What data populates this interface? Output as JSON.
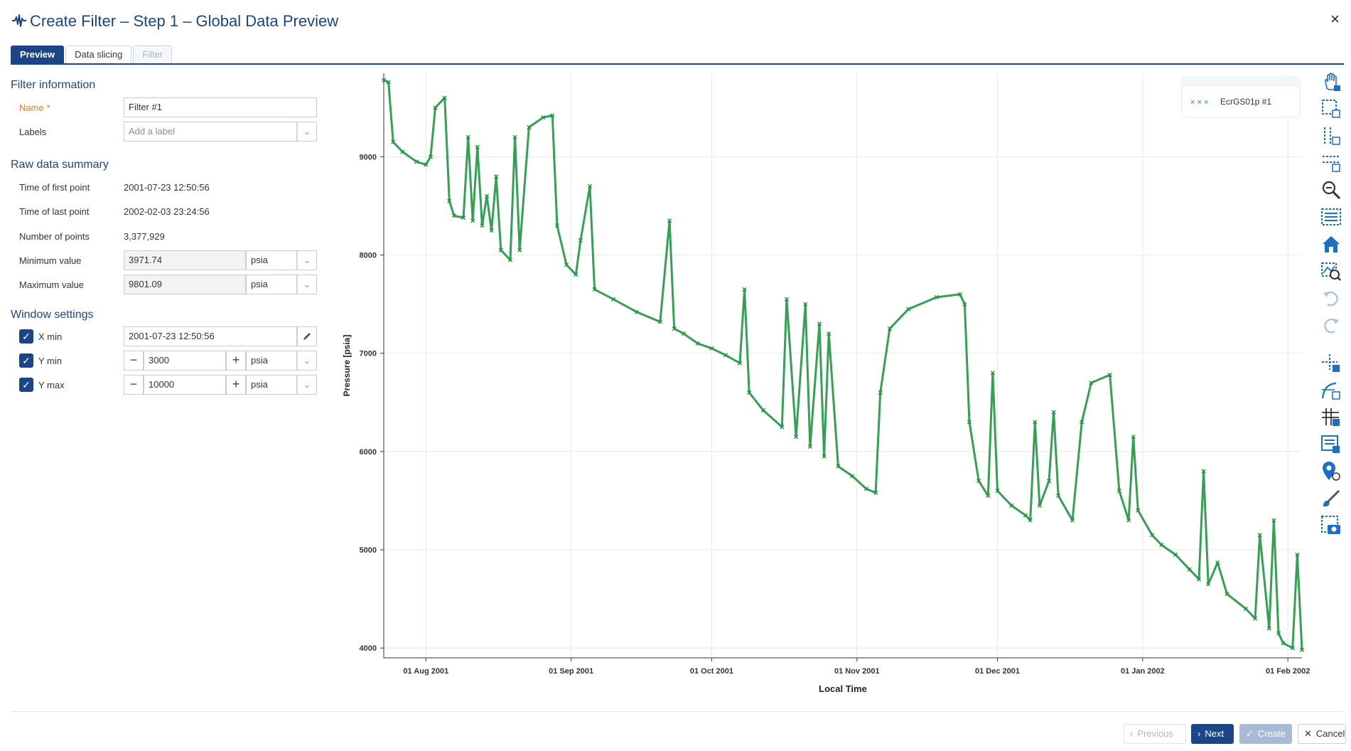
{
  "header": {
    "title": "Create Filter – Step 1 – Global Data Preview",
    "icon": "waveform-icon",
    "close_symbol": "×"
  },
  "tabs": [
    {
      "label": "Preview",
      "state": "active"
    },
    {
      "label": "Data slicing",
      "state": "normal"
    },
    {
      "label": "Filter",
      "state": "disabled"
    }
  ],
  "filter_info": {
    "section_title": "Filter information",
    "name_label": "Name",
    "required_mark": "*",
    "name_value": "Filter #1",
    "labels_label": "Labels",
    "labels_placeholder": "Add a label"
  },
  "raw_summary": {
    "section_title": "Raw data summary",
    "first_point_label": "Time of first point",
    "first_point_value": "2001-07-23 12:50:56",
    "last_point_label": "Time of last point",
    "last_point_value": "2002-02-03 23:24:56",
    "num_points_label": "Number of points",
    "num_points_value": "3,377,929",
    "min_label": "Minimum value",
    "min_value": "3971.74",
    "min_unit": "psia",
    "max_label": "Maximum value",
    "max_value": "9801.09",
    "max_unit": "psia"
  },
  "window_settings": {
    "section_title": "Window settings",
    "xmin_label": "X min",
    "xmin_value": "2001-07-23 12:50:56",
    "ymin_label": "Y min",
    "ymin_value": "3000",
    "ymin_unit": "psia",
    "ymax_label": "Y max",
    "ymax_value": "10000",
    "ymax_unit": "psia",
    "minus": "−",
    "plus": "+"
  },
  "chart_data": {
    "type": "scatter",
    "title": "",
    "xlabel": "Local Time",
    "ylabel": "Pressure [psia]",
    "ylim": [
      3900,
      9850
    ],
    "xlim": [
      "2001-07-23",
      "2002-02-04"
    ],
    "xticks": [
      "01 Aug 2001",
      "01 Sep 2001",
      "01 Oct 2001",
      "01 Nov 2001",
      "01 Dec 2001",
      "01 Jan 2002",
      "01 Feb 2002"
    ],
    "xtick_dates": [
      "2001-08-01",
      "2001-09-01",
      "2001-10-01",
      "2001-11-01",
      "2001-12-01",
      "2002-01-01",
      "2002-02-01"
    ],
    "yticks": [
      4000,
      5000,
      6000,
      7000,
      8000,
      9000
    ],
    "grid": true,
    "legend_position": "top-right",
    "marker": "x",
    "series": [
      {
        "name": "EcrGS01p #1",
        "color": "#1e9641",
        "points": [
          [
            "2001-07-23",
            9780
          ],
          [
            "2001-07-24",
            9760
          ],
          [
            "2001-07-25",
            9150
          ],
          [
            "2001-07-27",
            9050
          ],
          [
            "2001-07-30",
            8950
          ],
          [
            "2001-08-01",
            8920
          ],
          [
            "2001-08-02",
            9000
          ],
          [
            "2001-08-03",
            9500
          ],
          [
            "2001-08-05",
            9600
          ],
          [
            "2001-08-06",
            8550
          ],
          [
            "2001-08-07",
            8400
          ],
          [
            "2001-08-09",
            8380
          ],
          [
            "2001-08-10",
            9200
          ],
          [
            "2001-08-11",
            8350
          ],
          [
            "2001-08-12",
            9100
          ],
          [
            "2001-08-13",
            8300
          ],
          [
            "2001-08-14",
            8600
          ],
          [
            "2001-08-15",
            8250
          ],
          [
            "2001-08-16",
            8800
          ],
          [
            "2001-08-17",
            8050
          ],
          [
            "2001-08-19",
            7950
          ],
          [
            "2001-08-20",
            9200
          ],
          [
            "2001-08-21",
            8050
          ],
          [
            "2001-08-23",
            9300
          ],
          [
            "2001-08-26",
            9400
          ],
          [
            "2001-08-28",
            9420
          ],
          [
            "2001-08-29",
            8300
          ],
          [
            "2001-08-31",
            7900
          ],
          [
            "2001-09-02",
            7800
          ],
          [
            "2001-09-03",
            8150
          ],
          [
            "2001-09-05",
            8700
          ],
          [
            "2001-09-06",
            7650
          ],
          [
            "2001-09-10",
            7550
          ],
          [
            "2001-09-15",
            7420
          ],
          [
            "2001-09-20",
            7320
          ],
          [
            "2001-09-22",
            8350
          ],
          [
            "2001-09-23",
            7250
          ],
          [
            "2001-09-25",
            7200
          ],
          [
            "2001-09-28",
            7100
          ],
          [
            "2001-10-01",
            7050
          ],
          [
            "2001-10-04",
            6980
          ],
          [
            "2001-10-07",
            6900
          ],
          [
            "2001-10-08",
            7650
          ],
          [
            "2001-10-09",
            6600
          ],
          [
            "2001-10-12",
            6420
          ],
          [
            "2001-10-16",
            6250
          ],
          [
            "2001-10-17",
            7550
          ],
          [
            "2001-10-19",
            6150
          ],
          [
            "2001-10-21",
            7500
          ],
          [
            "2001-10-22",
            6050
          ],
          [
            "2001-10-24",
            7300
          ],
          [
            "2001-10-25",
            5950
          ],
          [
            "2001-10-26",
            7200
          ],
          [
            "2001-10-28",
            5850
          ],
          [
            "2001-10-31",
            5750
          ],
          [
            "2001-11-03",
            5620
          ],
          [
            "2001-11-05",
            5580
          ],
          [
            "2001-11-06",
            6600
          ],
          [
            "2001-11-08",
            7250
          ],
          [
            "2001-11-12",
            7450
          ],
          [
            "2001-11-18",
            7570
          ],
          [
            "2001-11-23",
            7600
          ],
          [
            "2001-11-24",
            7500
          ],
          [
            "2001-11-25",
            6300
          ],
          [
            "2001-11-27",
            5700
          ],
          [
            "2001-11-29",
            5550
          ],
          [
            "2001-11-30",
            6800
          ],
          [
            "2001-12-01",
            5600
          ],
          [
            "2001-12-04",
            5450
          ],
          [
            "2001-12-07",
            5350
          ],
          [
            "2001-12-08",
            5300
          ],
          [
            "2001-12-09",
            6300
          ],
          [
            "2001-12-10",
            5450
          ],
          [
            "2001-12-12",
            5700
          ],
          [
            "2001-12-13",
            6400
          ],
          [
            "2001-12-14",
            5550
          ],
          [
            "2001-12-17",
            5300
          ],
          [
            "2001-12-19",
            6300
          ],
          [
            "2001-12-21",
            6700
          ],
          [
            "2001-12-25",
            6780
          ],
          [
            "2001-12-27",
            5600
          ],
          [
            "2001-12-29",
            5300
          ],
          [
            "2001-12-30",
            6150
          ],
          [
            "2001-12-31",
            5400
          ],
          [
            "2002-01-03",
            5150
          ],
          [
            "2002-01-05",
            5050
          ],
          [
            "2002-01-08",
            4950
          ],
          [
            "2002-01-11",
            4800
          ],
          [
            "2002-01-13",
            4700
          ],
          [
            "2002-01-14",
            5800
          ],
          [
            "2002-01-15",
            4650
          ],
          [
            "2002-01-17",
            4870
          ],
          [
            "2002-01-19",
            4550
          ],
          [
            "2002-01-23",
            4400
          ],
          [
            "2002-01-25",
            4300
          ],
          [
            "2002-01-26",
            5150
          ],
          [
            "2002-01-28",
            4200
          ],
          [
            "2002-01-29",
            5300
          ],
          [
            "2002-01-30",
            4150
          ],
          [
            "2002-01-31",
            4050
          ],
          [
            "2002-02-02",
            4000
          ],
          [
            "2002-02-03",
            4950
          ],
          [
            "2002-02-04",
            3980
          ]
        ]
      }
    ]
  },
  "toolbar": {
    "tools": [
      "pan-icon",
      "box-zoom-icon",
      "x-zoom-icon",
      "y-zoom-icon",
      "zoom-icon",
      "fit-icon",
      "home-icon",
      "zoom-region-icon",
      "undo-icon",
      "redo-icon",
      "crosshair-icon",
      "curve-icon",
      "grid-icon",
      "legend-icon",
      "marker-icon",
      "brush-icon",
      "snapshot-icon"
    ]
  },
  "footer": {
    "previous": "Previous",
    "next": "Next",
    "create": "Create",
    "cancel": "Cancel"
  }
}
